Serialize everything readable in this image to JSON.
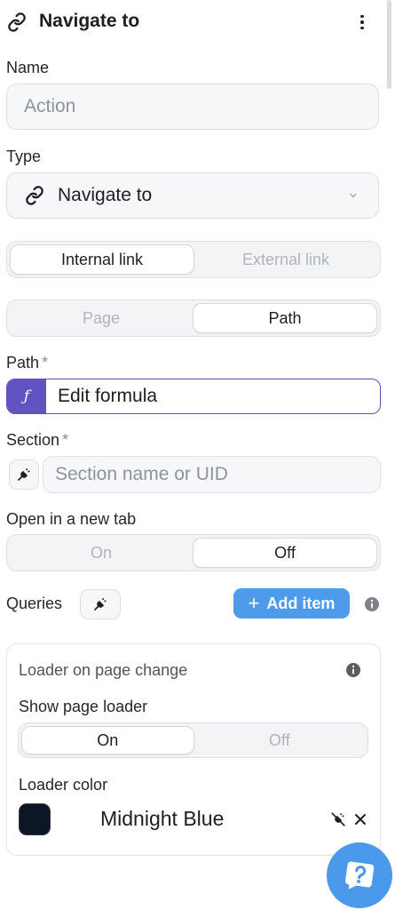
{
  "header": {
    "title": "Navigate to",
    "icon": "link-icon"
  },
  "name_field": {
    "label": "Name",
    "placeholder": "Action"
  },
  "type_field": {
    "label": "Type",
    "value": "Navigate to"
  },
  "link_toggle": {
    "options": [
      "Internal link",
      "External link"
    ],
    "selected": "Internal link"
  },
  "target_toggle": {
    "options": [
      "Page",
      "Path"
    ],
    "selected": "Path"
  },
  "path_field": {
    "label": "Path",
    "required_mark": "*",
    "fx_symbol": "ƒ",
    "value": "Edit formula"
  },
  "section_field": {
    "label": "Section",
    "required_mark": "*",
    "placeholder": "Section name or UID"
  },
  "new_tab": {
    "label": "Open in a new tab",
    "options": [
      "On",
      "Off"
    ],
    "selected": "Off"
  },
  "queries": {
    "label": "Queries",
    "add_label": "Add item",
    "add_symbol": "+"
  },
  "loader": {
    "title": "Loader on page change",
    "show_label": "Show page loader",
    "options": [
      "On",
      "Off"
    ],
    "selected": "On",
    "color_label": "Loader color",
    "color_name": "Midnight Blue",
    "color_hex": "#0c1627"
  },
  "colors": {
    "accent": "#4d9bea",
    "formula": "#6153c2"
  }
}
